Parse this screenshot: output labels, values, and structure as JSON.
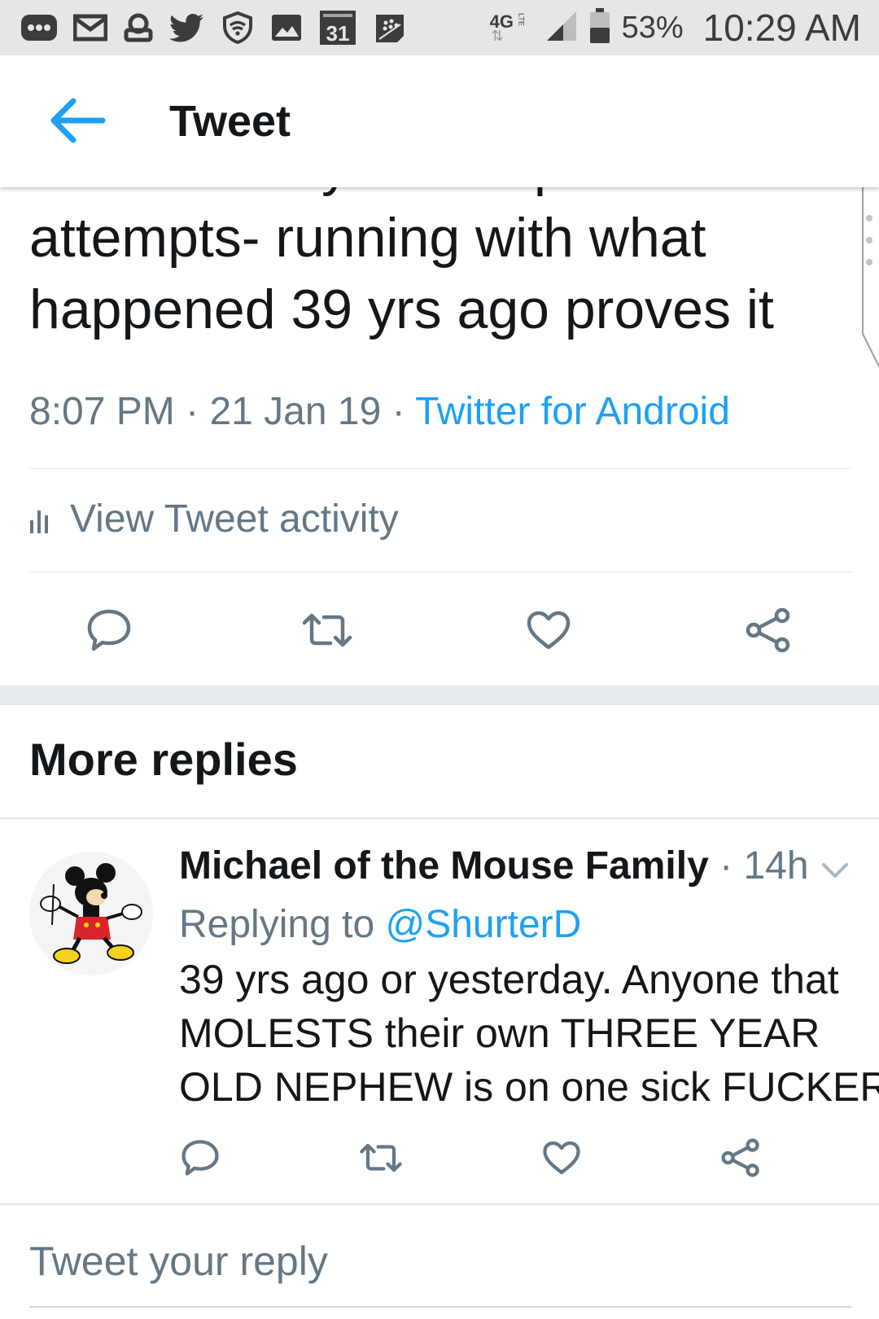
{
  "status_bar": {
    "network": "4G",
    "network_sub": "LTE",
    "calendar_day": "31",
    "battery_percent": "53%",
    "time": "10:29 AM",
    "icons": [
      "more-notifications-icon",
      "mail-icon",
      "voicemail-icon",
      "twitter-icon",
      "wifi-shield-icon",
      "gallery-icon",
      "calendar-icon",
      "blackberry-icon",
      "signal-icon",
      "battery-icon"
    ]
  },
  "app_bar": {
    "title": "Tweet",
    "back_icon": "back-arrow-icon"
  },
  "tweet": {
    "text_lines": [
      "that with all your desperate",
      "attempts- running with what",
      "happened 39 yrs ago proves it"
    ],
    "time": "8:07 PM",
    "separator": "·",
    "date": "21 Jan 19",
    "source": "Twitter for Android",
    "activity_label": "View Tweet activity",
    "actions": [
      "reply-icon",
      "retweet-icon",
      "like-icon",
      "share-icon"
    ]
  },
  "more_replies": {
    "heading": "More replies"
  },
  "reply": {
    "name": "Michael of the Mouse Family",
    "separator": "·",
    "time": "14h",
    "replying_prefix": "Replying to",
    "replying_handle": "@ShurterD",
    "text_lines": [
      "39 yrs ago or yesterday. Anyone that",
      "MOLESTS their own THREE YEAR",
      "OLD NEPHEW is on one sick FUCKER."
    ]
  },
  "compose": {
    "placeholder": "Tweet your reply"
  },
  "colors": {
    "accent": "#1da1f2",
    "text_primary": "#14171a",
    "text_secondary": "#657786",
    "divider": "#e1e8ed",
    "status_bar_bg": "#e6e6e6"
  }
}
